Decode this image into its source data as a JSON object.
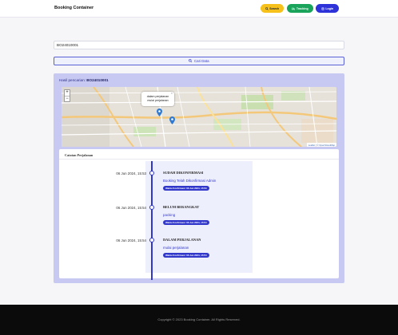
{
  "header": {
    "brand": "Booking Container",
    "buttons": {
      "search": "Search",
      "tracking": "Tracking",
      "login": "Login"
    }
  },
  "search": {
    "value": "BO24010001",
    "button_label": "Cari Data"
  },
  "results": {
    "title_prefix": "Hasil pencarian:",
    "booking_code": "BO24010001",
    "map": {
      "popup_text": "dalam perjalanan\nmulai perjalanan",
      "zoom_in": "+",
      "zoom_out": "−",
      "popup_close": "×",
      "attribution": "Leaflet | © OpenStreetMap"
    },
    "journey": {
      "title": "Catatan Perjalanan",
      "events": [
        {
          "date": "06 Jun 2024, 15:53",
          "status": "SUDAH DIKONFIRMASI",
          "description": "Booking Telah Dikonfirmasi Admin",
          "confirm_time": "Waktu Konfirmasi: 06 Jun 2024, 15:53"
        },
        {
          "date": "06 Jun 2024, 15:54",
          "status": "BELUM BERANGKAT",
          "description": "packing",
          "confirm_time": "Waktu Konfirmasi: 06 Jun 2024, 15:54"
        },
        {
          "date": "06 Jun 2024, 15:54",
          "status": "DALAM PERJALANAN",
          "description": "mulai perjalanan",
          "confirm_time": "Waktu Konfirmasi: 06 Jun 2024, 15:54"
        }
      ]
    }
  },
  "footer": {
    "copyright": "Copyright © 2023 Booking Container. All Rights Reserved."
  },
  "colors": {
    "primary": "#2d33d8",
    "search_button": "#f6c11a",
    "tracking_button": "#19a35b",
    "results_bg": "#c7c9f3",
    "footer_bg": "#0b0b0b"
  }
}
